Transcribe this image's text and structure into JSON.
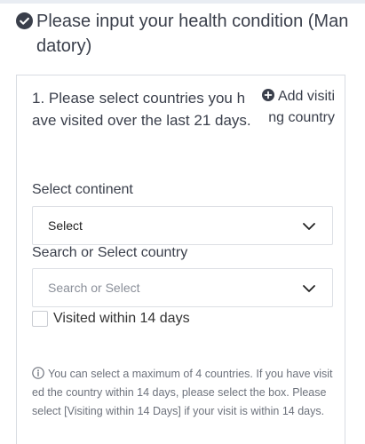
{
  "header": {
    "title": "Please input your health condition (Mandatory)"
  },
  "question": {
    "text": "1. Please select countries you have visited over the last 21 days.",
    "add_visit_label": "Add visiting country"
  },
  "continent": {
    "label": "Select continent",
    "value": "Select"
  },
  "country": {
    "label": "Search or Select country",
    "placeholder": "Search or Select"
  },
  "visited_14": {
    "label": "Visited within 14 days",
    "checked": false
  },
  "info": {
    "text": "You can select a maximum of 4 countries. If you have visited the country within 14 days, please select the box. Please select [Visiting within 14 Days] if your visit is within 14 days."
  },
  "colors": {
    "text": "#3a3f4b",
    "border": "#d8dce2",
    "icon": "#3a3f4b"
  }
}
